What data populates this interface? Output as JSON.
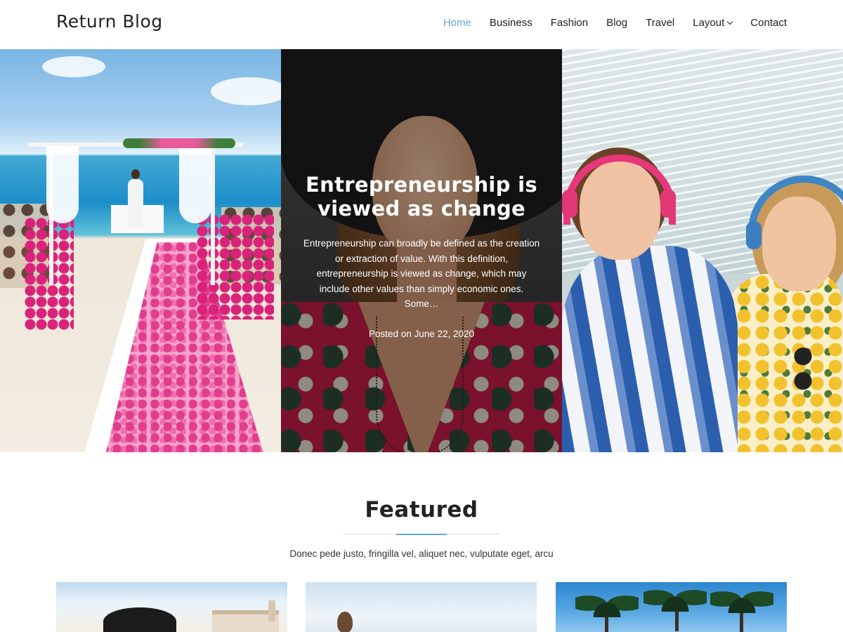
{
  "header": {
    "site_title": "Return Blog",
    "nav": [
      {
        "label": "Home",
        "active": true
      },
      {
        "label": "Business"
      },
      {
        "label": "Fashion"
      },
      {
        "label": "Blog"
      },
      {
        "label": "Travel"
      },
      {
        "label": "Layout",
        "has_dropdown": true,
        "icon": "chevron-down-icon"
      },
      {
        "label": "Contact"
      }
    ],
    "accent_color": "#63a7d6"
  },
  "hero": {
    "panels": [
      {
        "image": "beach wedding aisle with pink petals"
      },
      {
        "image": "woman in black hat",
        "title": "Entrepreneurship is viewed as change",
        "excerpt": "Entrepreneurship can broadly be defined as the creation or extraction of value. With this definition, entrepreneurship is viewed as change, which may include other values than simply economic ones. Some…",
        "posted": "Posted on June 22, 2020"
      },
      {
        "image": "two women with headphones on beach"
      }
    ]
  },
  "featured": {
    "title": "Featured",
    "subtitle": "Donec pede justo, fringilla vel, aliquet nec, vulputate eget, arcu",
    "cards": [
      {
        "image": "woman with black hat and camera"
      },
      {
        "image": "woman by the sea"
      },
      {
        "image": "palm trees and blue sky"
      }
    ]
  }
}
